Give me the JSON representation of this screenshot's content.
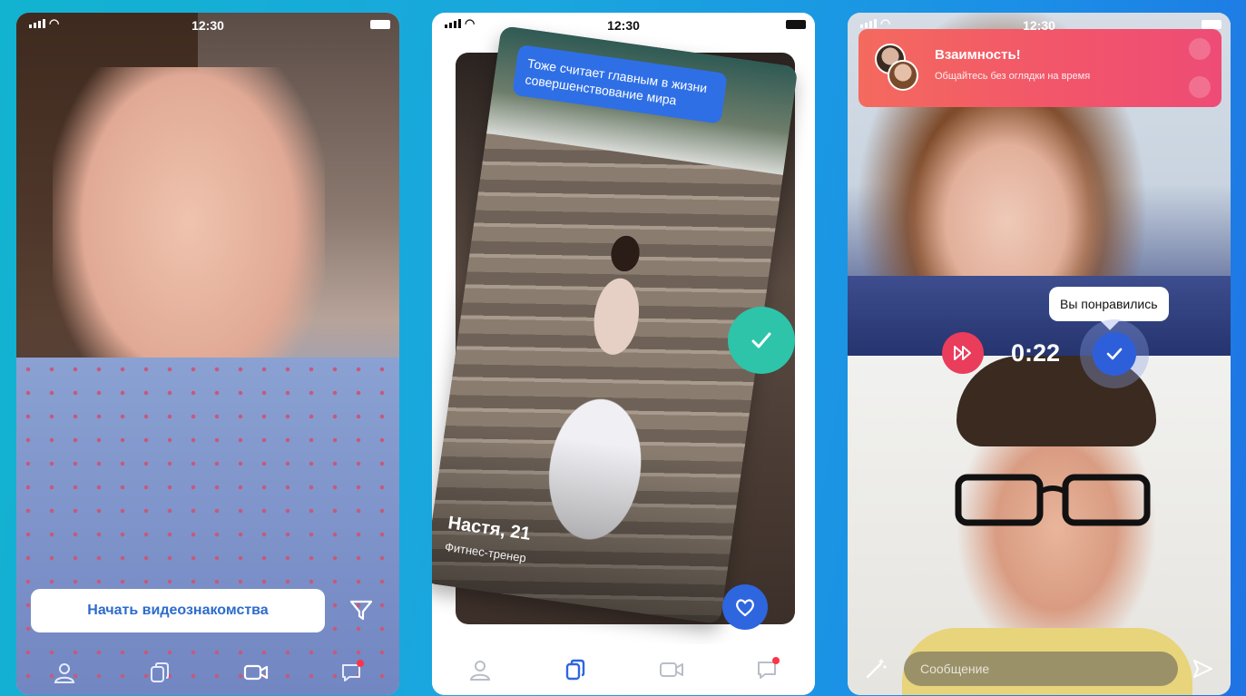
{
  "status_bar": {
    "time": "12:30"
  },
  "screen1": {
    "cta_label": "Начать видеознакомства",
    "tabs": [
      {
        "icon": "profile-icon"
      },
      {
        "icon": "cards-icon"
      },
      {
        "icon": "video-icon"
      },
      {
        "icon": "messages-icon",
        "badge": true
      }
    ]
  },
  "screen2": {
    "card": {
      "tagline": "Тоже считает главным в жизни совершенствование мира",
      "name": "Настя, 21",
      "job": "Фитнес-тренер"
    },
    "active_tab": "cards-icon",
    "accent_color": "#2e66e0",
    "check_color": "#2ec4a9"
  },
  "screen3": {
    "notification": {
      "title": "Взаимность!",
      "subtitle": "Общайтесь без оглядки на время"
    },
    "like_bubble": "Вы понравились",
    "timer": "0:22",
    "message_placeholder": "Сообщение"
  }
}
